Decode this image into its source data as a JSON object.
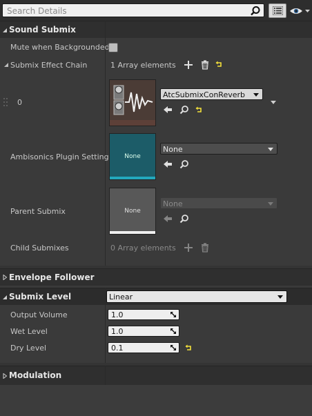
{
  "search": {
    "placeholder": "Search Details"
  },
  "icons": {
    "search": "search-icon",
    "view_options": "list-view-icon",
    "visibility": "eye-icon",
    "add": "plus-icon",
    "delete": "trash-icon",
    "reset": "reset-arrow-icon",
    "use_selected": "arrow-left-icon",
    "browse": "magnifier-icon"
  },
  "categories": {
    "sound_submix": "Sound Submix",
    "envelope_follower": "Envelope Follower",
    "submix_level": "Submix Level",
    "modulation": "Modulation"
  },
  "sound_submix": {
    "mute_label": "Mute when Backgrounded",
    "effect_chain_label": "Submix Effect Chain",
    "effect_chain_count": "1 Array elements",
    "index_label": "0",
    "effect_asset": "AtcSubmixConReverb",
    "ambisonics_label": "Ambisonics Plugin Settings",
    "ambisonics_thumb": "None",
    "ambisonics_value": "None",
    "parent_label": "Parent Submix",
    "parent_thumb": "None",
    "parent_value": "None",
    "child_label": "Child Submixes",
    "child_count": "0 Array elements"
  },
  "submix_level": {
    "mode": "Linear",
    "output_volume_label": "Output Volume",
    "output_volume": "1.0",
    "wet_level_label": "Wet Level",
    "wet_level": "1.0",
    "dry_level_label": "Dry Level",
    "dry_level": "0.1"
  },
  "colors": {
    "background": "#3a3a3a",
    "category_header": "#2f2f2f",
    "reset_yellow": "#f5e23b",
    "ambisonics_thumb": "#1c5c68"
  }
}
